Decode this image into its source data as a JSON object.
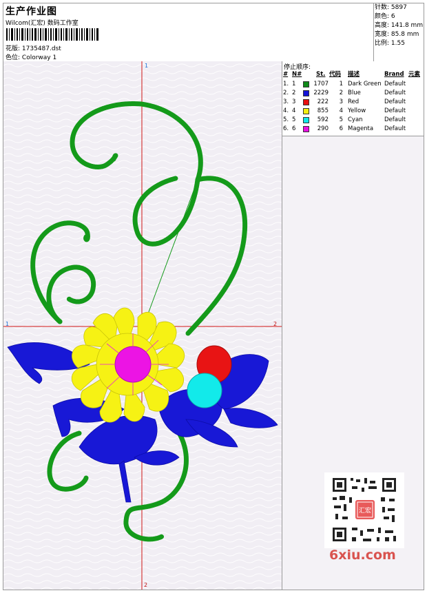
{
  "header": {
    "title": "生产作业图",
    "subtitle": "Wilcom(汇宏) 数码工作室",
    "file_label": "花版:",
    "file_value": "1735487.dst",
    "color_label": "色位:",
    "color_value": "Colorway 1"
  },
  "stats": [
    {
      "label": "针数:",
      "value": "5897"
    },
    {
      "label": "颜色:",
      "value": "6"
    },
    {
      "label": "高度:",
      "value": "141.8 mm"
    },
    {
      "label": "宽度:",
      "value": "85.8 mm"
    },
    {
      "label": "比例:",
      "value": "1.55"
    }
  ],
  "color_table": {
    "title": "停止顺序:",
    "headers": [
      "#",
      "N#",
      "St.",
      "代码",
      "描述",
      "Brand",
      "元素"
    ],
    "rows": [
      {
        "num": "1.",
        "n": "1",
        "color": "#108a18",
        "st": "1707",
        "code": "1",
        "desc": "Dark Green",
        "brand": "Default"
      },
      {
        "num": "2.",
        "n": "2",
        "color": "#1414d8",
        "st": "2229",
        "code": "2",
        "desc": "Blue",
        "brand": "Default"
      },
      {
        "num": "3.",
        "n": "3",
        "color": "#e81010",
        "st": "222",
        "code": "3",
        "desc": "Red",
        "brand": "Default"
      },
      {
        "num": "4.",
        "n": "4",
        "color": "#f4f010",
        "st": "855",
        "code": "4",
        "desc": "Yellow",
        "brand": "Default"
      },
      {
        "num": "5.",
        "n": "5",
        "color": "#10e8e8",
        "st": "592",
        "code": "5",
        "desc": "Cyan",
        "brand": "Default"
      },
      {
        "num": "6.",
        "n": "6",
        "color": "#e810e0",
        "st": "290",
        "code": "6",
        "desc": "Magenta",
        "brand": "Default"
      }
    ]
  },
  "axes": {
    "top": "1",
    "left": "1",
    "right": "2",
    "bottom": "2"
  },
  "watermark": "6xiu.com",
  "qr_stamp": "汇宏"
}
